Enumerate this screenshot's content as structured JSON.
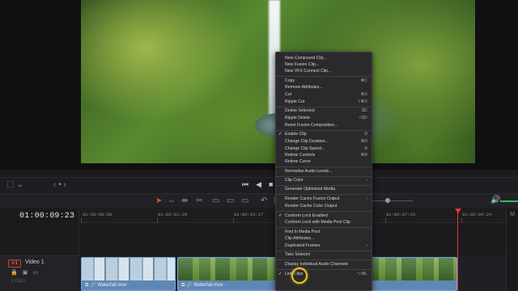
{
  "viewer": {
    "transport": [
      "⏮",
      "◀",
      "■",
      "▶",
      "⏭",
      "⟲"
    ]
  },
  "timeline": {
    "timecode": "01:00:09:23",
    "ruler": [
      "01:00:00:00",
      "01:00:01:28",
      "01:00:03:27",
      "01:00:07:25",
      "01:00:09:24"
    ],
    "track": {
      "badge": "V1",
      "name": "Video 1",
      "clip_count": "2 Clips"
    },
    "clips": [
      {
        "name": "Waterfall.mov"
      },
      {
        "name": "Waterfall.mov"
      }
    ]
  },
  "context_menu": {
    "items": [
      {
        "label": "New Compound Clip...",
        "shortcut": ""
      },
      {
        "label": "New Fusion Clip...",
        "shortcut": ""
      },
      {
        "label": "New VFX Connect Clip...",
        "shortcut": ""
      },
      {
        "label": "Copy",
        "shortcut": "⌘C"
      },
      {
        "label": "Remove Attributes...",
        "shortcut": ""
      },
      {
        "label": "Cut",
        "shortcut": "⌘X"
      },
      {
        "label": "Ripple Cut",
        "shortcut": "⇧⌘X"
      },
      {
        "label": "Delete Selected",
        "shortcut": "⌦"
      },
      {
        "label": "Ripple Delete",
        "shortcut": "⇧⌦"
      },
      {
        "label": "Reset Fusion Composition...",
        "shortcut": ""
      },
      {
        "label": "Enable Clip",
        "shortcut": "D",
        "checked": true
      },
      {
        "label": "Change Clip Duration...",
        "shortcut": "⌘D"
      },
      {
        "label": "Change Clip Speed...",
        "shortcut": "R"
      },
      {
        "label": "Retime Controls",
        "shortcut": "⌘R"
      },
      {
        "label": "Retime Curve",
        "shortcut": ""
      },
      {
        "label": "Normalise Audio Levels...",
        "shortcut": ""
      },
      {
        "label": "Clip Color",
        "shortcut": "",
        "submenu": true
      },
      {
        "label": "Generate Optimized Media",
        "shortcut": ""
      },
      {
        "label": "Render Cache Fusion Output",
        "shortcut": "",
        "submenu": true
      },
      {
        "label": "Render Cache Color Output",
        "shortcut": ""
      },
      {
        "label": "Conform Lock Enabled",
        "shortcut": "",
        "checked": true
      },
      {
        "label": "Conform Lock with Media Pool Clip",
        "shortcut": ""
      },
      {
        "label": "Find In Media Pool",
        "shortcut": ""
      },
      {
        "label": "Clip Attributes...",
        "shortcut": ""
      },
      {
        "label": "Duplicated Frames",
        "shortcut": "",
        "submenu": true
      },
      {
        "label": "Take Selector",
        "shortcut": ""
      },
      {
        "label": "Display Individual Audio Channels",
        "shortcut": ""
      },
      {
        "label": "Link Clips",
        "shortcut": "⌥⌘L",
        "checked": true
      }
    ]
  },
  "colors": {
    "playhead": "#e0392c",
    "clip": "#5f87b5",
    "highlight": "#f2c21b",
    "accent_green": "#2fbf4f"
  }
}
